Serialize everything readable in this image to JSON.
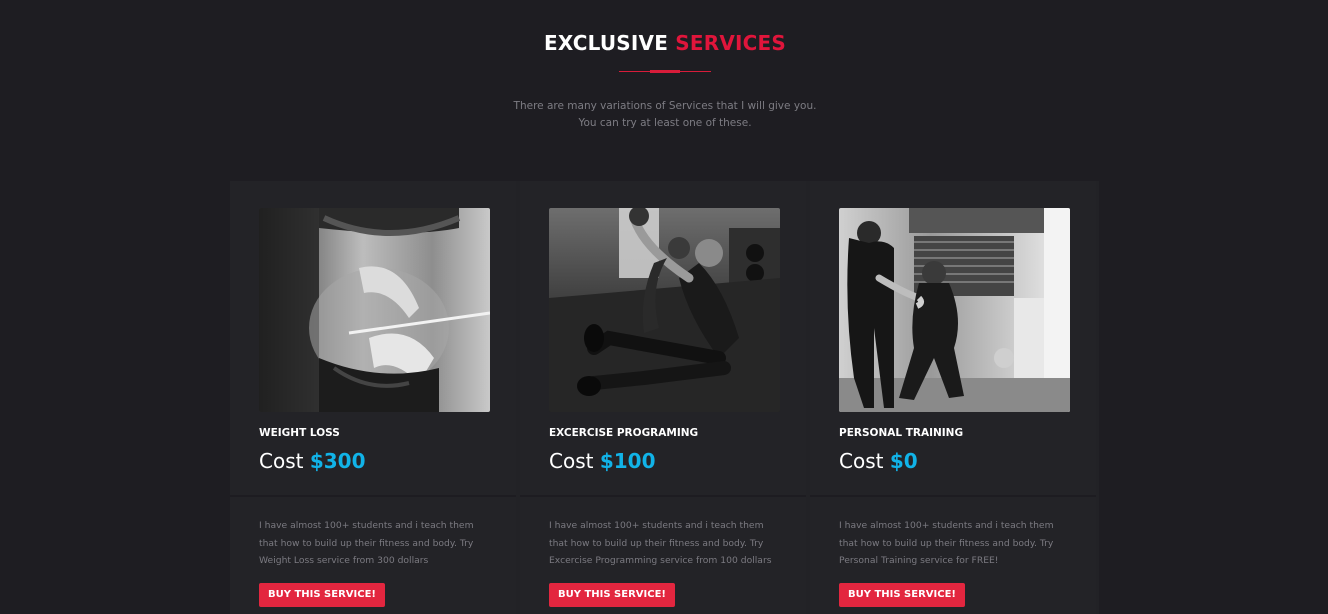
{
  "header": {
    "title_part1": "EXCLUSIVE",
    "title_part2": "SERVICES",
    "subtitle_line1": "There are many variations of Services that I will give you.",
    "subtitle_line2": "You can try at least one of these."
  },
  "colors": {
    "background": "#1e1d22",
    "card": "#232327",
    "accent_red": "#e0153b",
    "price_blue": "#11b3e8",
    "button_red": "#e3263f"
  },
  "services": [
    {
      "name": "WEIGHT LOSS",
      "cost_label": "Cost",
      "price": "$300",
      "desc_line1": "I have almost 100+ students and i teach them",
      "desc_line2": "that how to build up their fitness and body. Try",
      "desc_line3": "Weight Loss service from 300 dollars",
      "button": "BUY THIS SERVICE!",
      "image": "weight-loss-photo"
    },
    {
      "name": "EXCERCISE PROGRAMING",
      "cost_label": "Cost",
      "price": "$100",
      "desc_line1": "I have almost 100+ students and i teach them",
      "desc_line2": "that how to build up their fitness and body. Try",
      "desc_line3": "Excercise Programming service from 100 dollars",
      "button": "BUY THIS SERVICE!",
      "image": "exercise-programming-photo"
    },
    {
      "name": "PERSONAL TRAINING",
      "cost_label": "Cost",
      "price": "$0",
      "desc_line1": "I have almost 100+ students and i teach them",
      "desc_line2": "that how to build up their fitness and body. Try",
      "desc_line3": "Personal Training service for FREE!",
      "button": "BUY THIS SERVICE!",
      "image": "personal-training-photo"
    }
  ]
}
